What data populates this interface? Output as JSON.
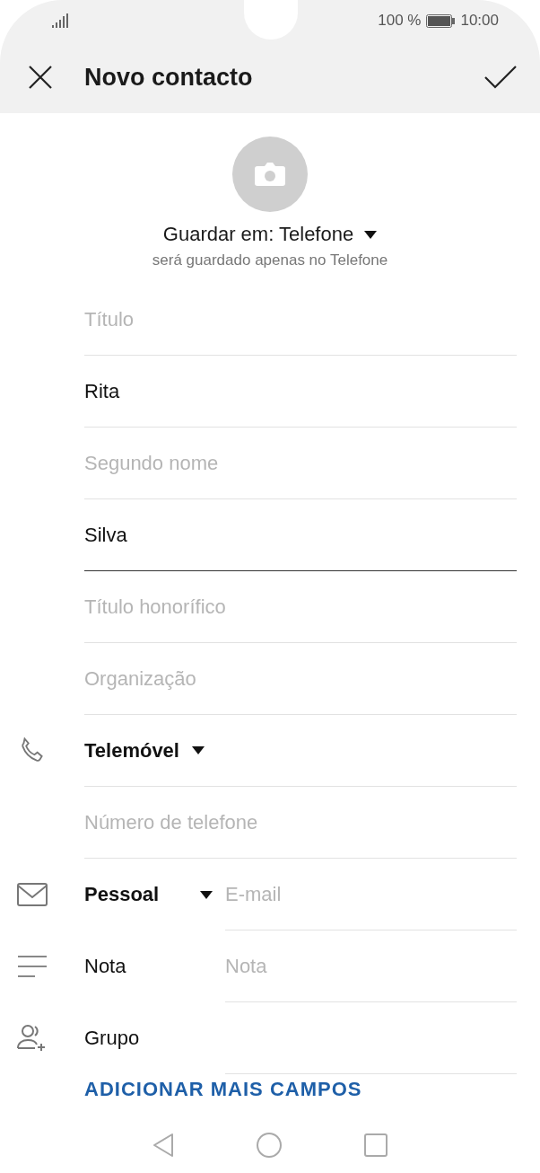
{
  "status_bar": {
    "battery": "100 %",
    "time": "10:00"
  },
  "header": {
    "title": "Novo contacto"
  },
  "save_location": {
    "label": "Guardar em: Telefone",
    "note": "será guardado apenas no Telefone"
  },
  "fields": [
    {
      "kind": "text",
      "placeholder": "Título",
      "focused": false
    },
    {
      "kind": "text",
      "value": "Rita",
      "focused": false
    },
    {
      "kind": "text",
      "placeholder": "Segundo nome",
      "focused": false
    },
    {
      "kind": "text",
      "value": "Silva",
      "focused": true
    },
    {
      "kind": "text",
      "placeholder": "Título honorífico",
      "focused": false
    },
    {
      "kind": "text",
      "placeholder": "Organização",
      "focused": false
    },
    {
      "kind": "phone",
      "label": "Telemóvel",
      "focused": false
    },
    {
      "kind": "text",
      "placeholder": "Número de telefone",
      "focused": false
    },
    {
      "kind": "email",
      "label": "Pessoal",
      "placeholder": "E-mail",
      "focused": false
    },
    {
      "kind": "note",
      "label": "Nota",
      "placeholder": "Nota",
      "focused": false
    },
    {
      "kind": "group",
      "label": "Grupo",
      "focused": false
    }
  ],
  "add_more": "ADICIONAR MAIS CAMPOS"
}
